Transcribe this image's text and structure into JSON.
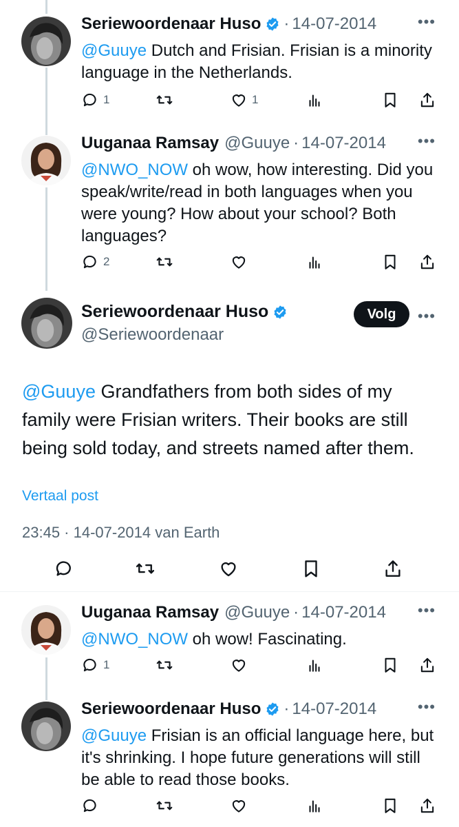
{
  "colors": {
    "link": "#1d9bf0",
    "text": "#0f1419",
    "secondary": "#536471",
    "verified": "#1d9bf0",
    "follow_bg": "#0f1419"
  },
  "replies_before": [
    {
      "author_name": "Seriewoordenaar Huso",
      "verified": true,
      "handle": "",
      "separator": "·",
      "date": "14-07-2014",
      "mention": "@Guuye",
      "text": " Dutch and Frisian. Frisian is a minority language in the Netherlands.",
      "reply_count": "1",
      "like_count": "1",
      "icons": [
        "reply-icon",
        "retweet-icon",
        "like-icon",
        "views-icon",
        "bookmark-icon",
        "share-icon"
      ]
    },
    {
      "author_name": "Uuganaa Ramsay",
      "verified": false,
      "handle": "@Guuye",
      "separator": "·",
      "date": "14-07-2014",
      "mention": "@NWO_NOW",
      "text": " oh wow, how interesting. Did you speak/write/read in both languages when you were young? How about your school? Both languages?",
      "reply_count": "2",
      "like_count": ""
    }
  ],
  "main_post": {
    "author_name": "Seriewoordenaar Huso",
    "verified": true,
    "handle": "@Seriewoordenaar",
    "follow_label": "Volg",
    "mention": "@Guuye",
    "text": " Grandfathers from both sides of my family were Frisian writers. Their books are still being sold today, and streets named after them.",
    "translate_label": "Vertaal post",
    "meta": "23:45 · 14-07-2014 van Earth"
  },
  "replies_after": [
    {
      "author_name": "Uuganaa Ramsay",
      "verified": false,
      "handle": "@Guuye",
      "separator": "·",
      "date": "14-07-2014",
      "mention": "@NWO_NOW",
      "text": " oh wow! Fascinating.",
      "reply_count": "1",
      "like_count": ""
    },
    {
      "author_name": "Seriewoordenaar Huso",
      "verified": true,
      "handle": "",
      "separator": "·",
      "date": "14-07-2014",
      "mention": "@Guuye",
      "text": " Frisian is an official language here, but it's shrinking. I hope future generations will still be able to read those books.",
      "reply_count": "",
      "like_count": ""
    }
  ]
}
